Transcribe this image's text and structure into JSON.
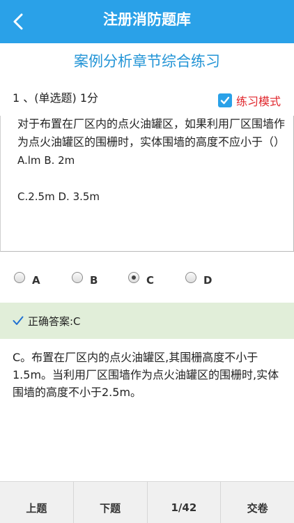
{
  "header": {
    "title": "注册消防题库",
    "back_icon": "chevron-left-icon",
    "color": "#2aa1e8"
  },
  "section_title": "案例分析章节综合练习",
  "question": {
    "meta": "1 、(单选题) 1分",
    "text": "对于布置在厂区内的点火油罐区，如果利用厂区围墙作为点火油罐区的围栅时，实体围墙的高度不应小于（）",
    "options_line1": "A.lm B. 2m",
    "options_line2": "C.2.5m D. 3.5m"
  },
  "mode": {
    "label": "练习模式",
    "checked": true,
    "label_color": "#e0252b"
  },
  "choices": [
    {
      "label": "A",
      "selected": false
    },
    {
      "label": "B",
      "selected": false
    },
    {
      "label": "C",
      "selected": true
    },
    {
      "label": "D",
      "selected": false
    }
  ],
  "answer": {
    "text": "正确答案:C",
    "bar_color": "#e1eed9"
  },
  "explanation": "C。布置在厂区内的点火油罐区,其围栅高度不小于1.5m。当利用厂区围墙作为点火油罐区的围栅时,实体围墙的高度不小于2.5m。",
  "footer": {
    "prev_label": "上题",
    "next_label": "下题",
    "counter": "1/42",
    "submit_label": "交卷"
  }
}
